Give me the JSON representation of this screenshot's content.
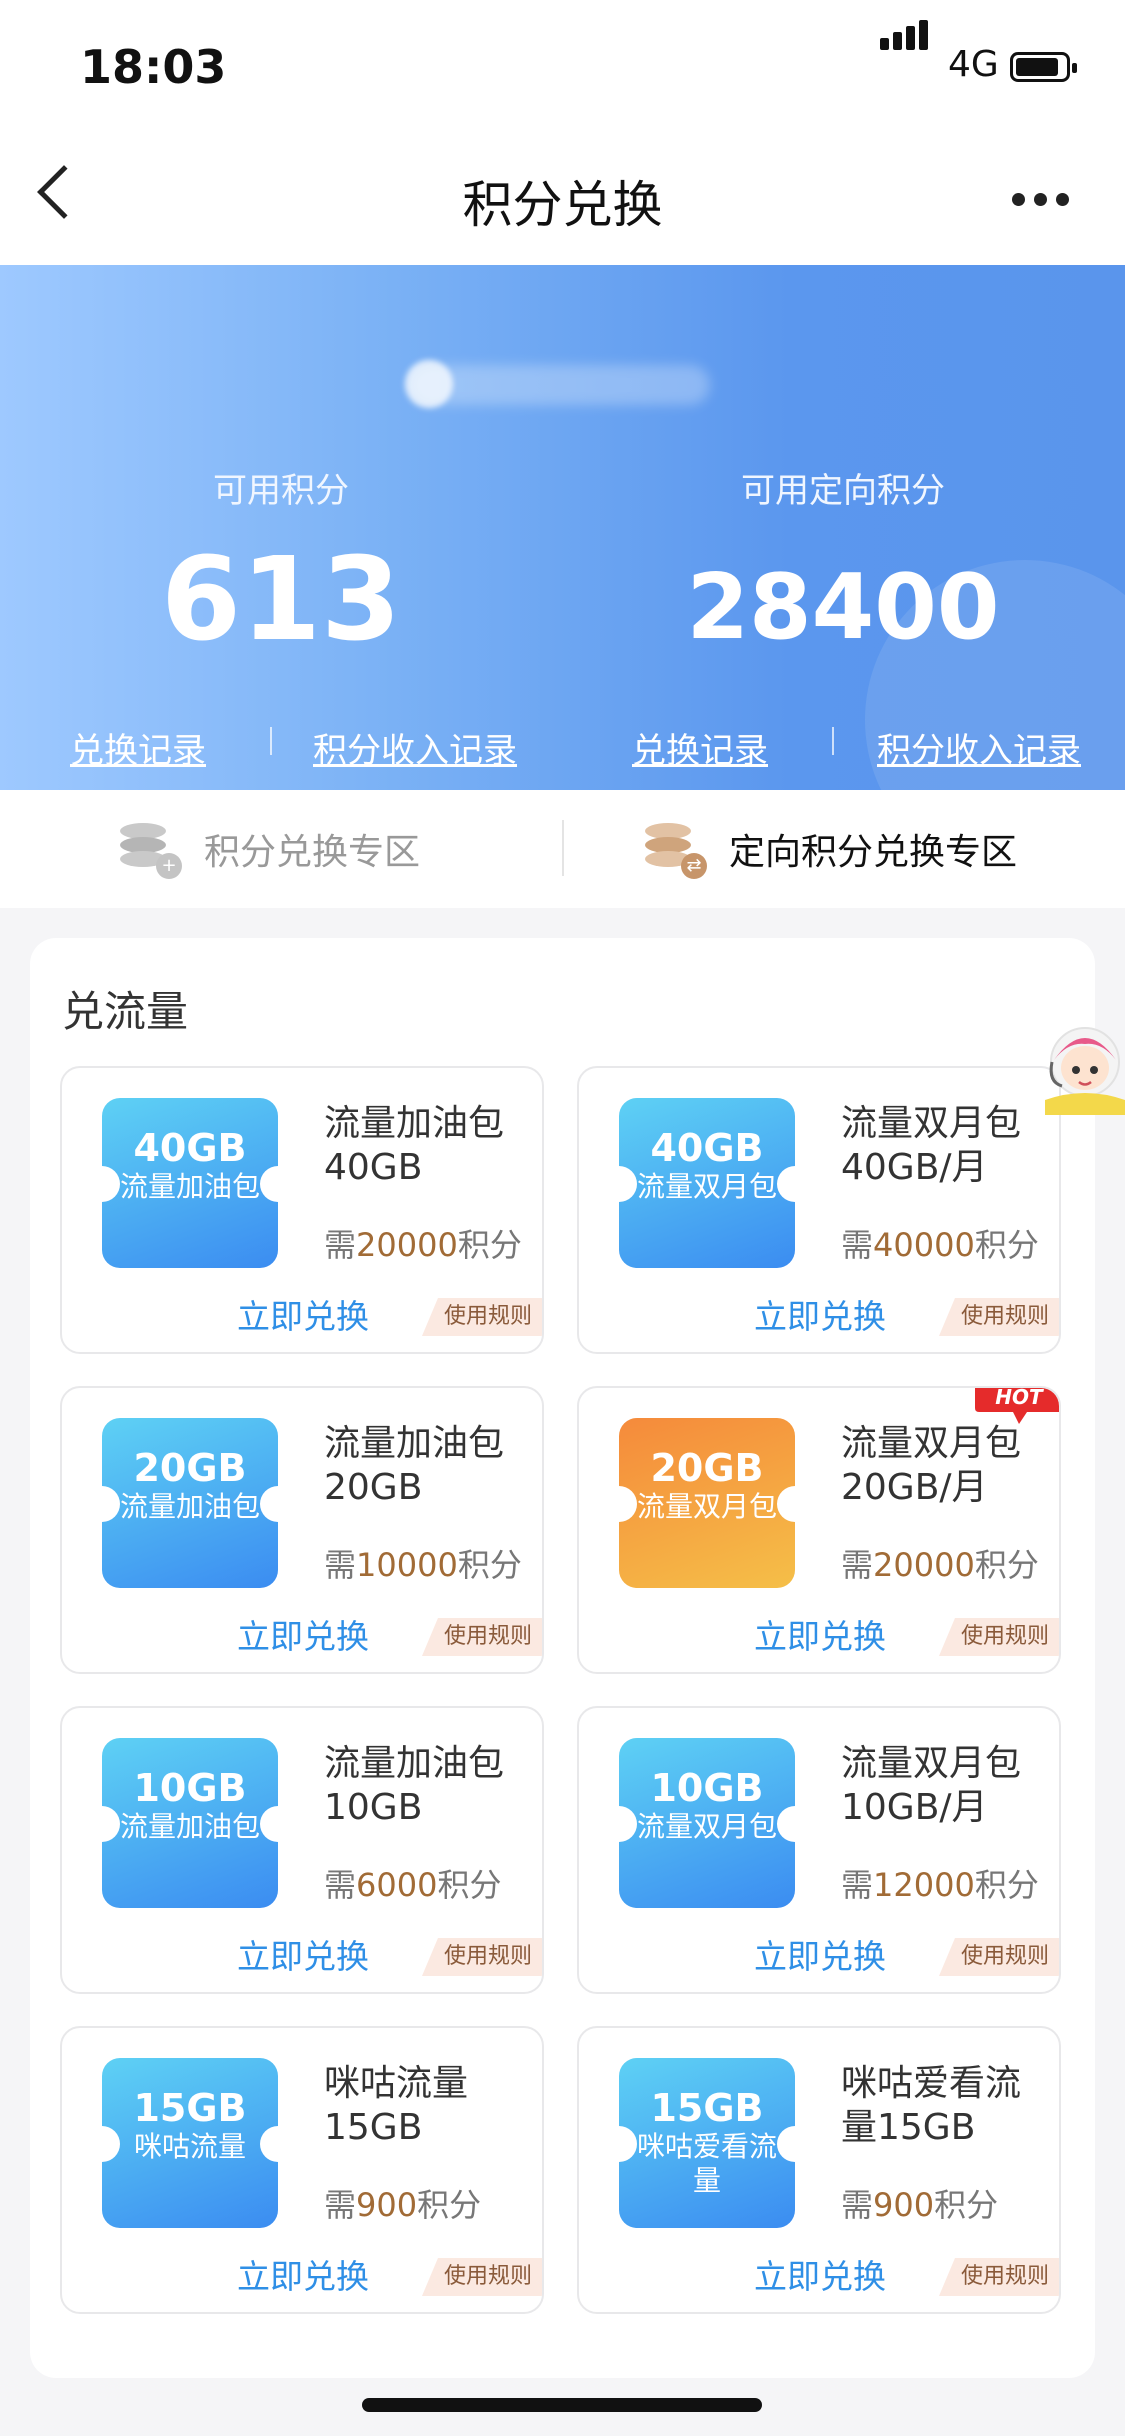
{
  "status": {
    "time": "18:03",
    "network": "4G"
  },
  "nav": {
    "title": "积分兑换"
  },
  "header": {
    "phone_masked": "176****2561",
    "left": {
      "label": "可用积分",
      "value": "613",
      "link1": "兑换记录",
      "link2": "积分收入记录"
    },
    "right": {
      "label": "可用定向积分",
      "value": "28400",
      "link1": "兑换记录",
      "link2": "积分收入记录"
    }
  },
  "tabs": [
    {
      "label": "积分兑换专区",
      "icon": "coins-icon",
      "active": false
    },
    {
      "label": "定向积分兑换专区",
      "icon": "coins-exchange-icon",
      "active": true
    }
  ],
  "section": {
    "title": "兑流量"
  },
  "cards": [
    {
      "gb": "40GB",
      "ticket_name": "流量加油包",
      "title": "流量加油包40GB",
      "cost_prefix": "需",
      "cost": "20000",
      "cost_suffix": "积分",
      "redeem": "立即兑换",
      "rules": "使用规则",
      "style": "blue",
      "hot": false
    },
    {
      "gb": "40GB",
      "ticket_name": "流量双月包",
      "title": "流量双月包40GB/月",
      "cost_prefix": "需",
      "cost": "40000",
      "cost_suffix": "积分",
      "redeem": "立即兑换",
      "rules": "使用规则",
      "style": "blue",
      "hot": false
    },
    {
      "gb": "20GB",
      "ticket_name": "流量加油包",
      "title": "流量加油包20GB",
      "cost_prefix": "需",
      "cost": "10000",
      "cost_suffix": "积分",
      "redeem": "立即兑换",
      "rules": "使用规则",
      "style": "blue",
      "hot": false
    },
    {
      "gb": "20GB",
      "ticket_name": "流量双月包",
      "title": "流量双月包20GB/月",
      "cost_prefix": "需",
      "cost": "20000",
      "cost_suffix": "积分",
      "redeem": "立即兑换",
      "rules": "使用规则",
      "style": "orange",
      "hot": true,
      "hot_label": "HOT"
    },
    {
      "gb": "10GB",
      "ticket_name": "流量加油包",
      "title": "流量加油包10GB",
      "cost_prefix": "需",
      "cost": "6000",
      "cost_suffix": "积分",
      "redeem": "立即兑换",
      "rules": "使用规则",
      "style": "blue",
      "hot": false
    },
    {
      "gb": "10GB",
      "ticket_name": "流量双月包",
      "title": "流量双月包10GB/月",
      "cost_prefix": "需",
      "cost": "12000",
      "cost_suffix": "积分",
      "redeem": "立即兑换",
      "rules": "使用规则",
      "style": "blue",
      "hot": false
    },
    {
      "gb": "15GB",
      "ticket_name": "咪咕流量",
      "title": "咪咕流量15GB",
      "cost_prefix": "需",
      "cost": "900",
      "cost_suffix": "积分",
      "redeem": "立即兑换",
      "rules": "使用规则",
      "style": "blue",
      "hot": false
    },
    {
      "gb": "15GB",
      "ticket_name": "咪咕爱看流量",
      "title": "咪咕爱看流量15GB",
      "cost_prefix": "需",
      "cost": "900",
      "cost_suffix": "积分",
      "redeem": "立即兑换",
      "rules": "使用规则",
      "style": "blue",
      "hot": false
    }
  ],
  "colors": {
    "accent": "#2f8fe6",
    "cost": "#a16b36",
    "hot": "#e52b2b"
  }
}
